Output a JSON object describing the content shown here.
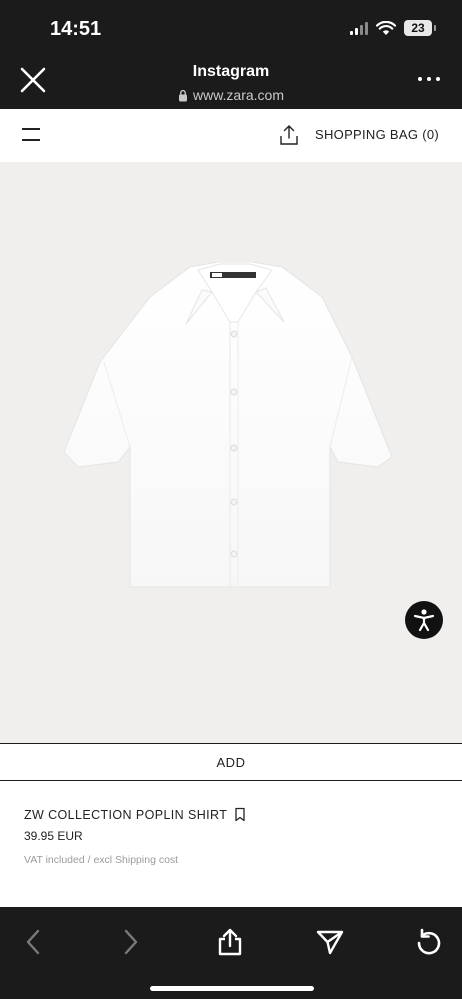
{
  "status_bar": {
    "time": "14:51",
    "battery": "23"
  },
  "browser": {
    "title": "Instagram",
    "url": "www.zara.com"
  },
  "zara_header": {
    "shopping_bag_label": "SHOPPING BAG (0)"
  },
  "product": {
    "add_label": "ADD",
    "name": "ZW COLLECTION POPLIN SHIRT",
    "price": "39.95 EUR",
    "vat_note": "VAT included / excl Shipping cost"
  },
  "colors": {
    "bar_background": "#1b1b1b",
    "product_background": "#f1efed"
  },
  "icons": [
    "close-icon",
    "lock-icon",
    "more-icon",
    "menu-icon",
    "share-icon",
    "accessibility-icon",
    "bookmark-icon",
    "back-icon",
    "forward-icon",
    "send-icon",
    "reload-icon"
  ]
}
